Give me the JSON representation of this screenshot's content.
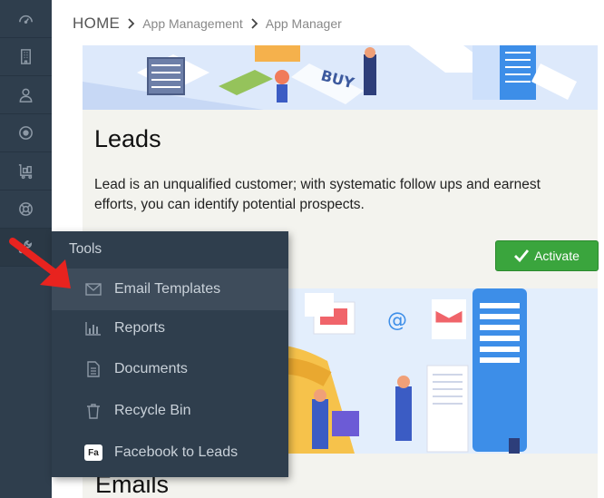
{
  "sidebar": {
    "items": [
      {
        "icon": "dashboard-icon"
      },
      {
        "icon": "building-icon"
      },
      {
        "icon": "user-icon"
      },
      {
        "icon": "target-icon"
      },
      {
        "icon": "cart-icon"
      },
      {
        "icon": "lifebuoy-icon"
      },
      {
        "icon": "wrench-icon"
      }
    ]
  },
  "breadcrumb": {
    "home": "HOME",
    "items": [
      "App Management",
      "App Manager"
    ]
  },
  "leads": {
    "title": "Leads",
    "description": "Lead is an unqualified customer; with systematic follow ups and earnest efforts, you can identify potential prospects.",
    "activate_label": "Activate"
  },
  "emails": {
    "title": "Emails"
  },
  "tools_menu": {
    "header": "Tools",
    "items": [
      {
        "label": "Email Templates",
        "icon": "envelope-icon"
      },
      {
        "label": "Reports",
        "icon": "bar-chart-icon"
      },
      {
        "label": "Documents",
        "icon": "document-icon"
      },
      {
        "label": "Recycle Bin",
        "icon": "trash-icon"
      },
      {
        "label": "Facebook to Leads",
        "icon": "fa-badge-icon",
        "badge": "Fa"
      }
    ]
  },
  "colors": {
    "sidebar_bg": "#2f3e4d",
    "activate_green": "#3aa53d",
    "annotation_arrow": "#e8231f"
  }
}
